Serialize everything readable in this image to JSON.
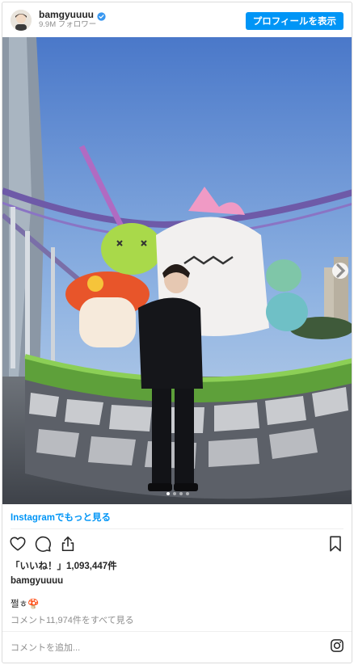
{
  "header": {
    "username": "bamgyuuuu",
    "followers": "9.9M フォロワー",
    "profile_button": "プロフィールを表示"
  },
  "photo": {
    "carousel_total": 4,
    "carousel_active": 1
  },
  "footer": {
    "more_link": "Instagramでもっと見る",
    "likes": "「いいね！」1,093,447件",
    "caption_user": "bamgyuuuu",
    "caption_text": "쩔ㅎ🍄",
    "view_comments": "コメント11,974件をすべて見る",
    "add_comment_placeholder": "コメントを追加..."
  },
  "colors": {
    "accent": "#0095f6",
    "secondary_text": "#8e8e8e",
    "primary_text": "#262626"
  },
  "icons": [
    "verified-badge-icon",
    "heart-icon",
    "comment-icon",
    "share-icon",
    "bookmark-icon",
    "instagram-logo-icon",
    "chevron-right-icon"
  ]
}
